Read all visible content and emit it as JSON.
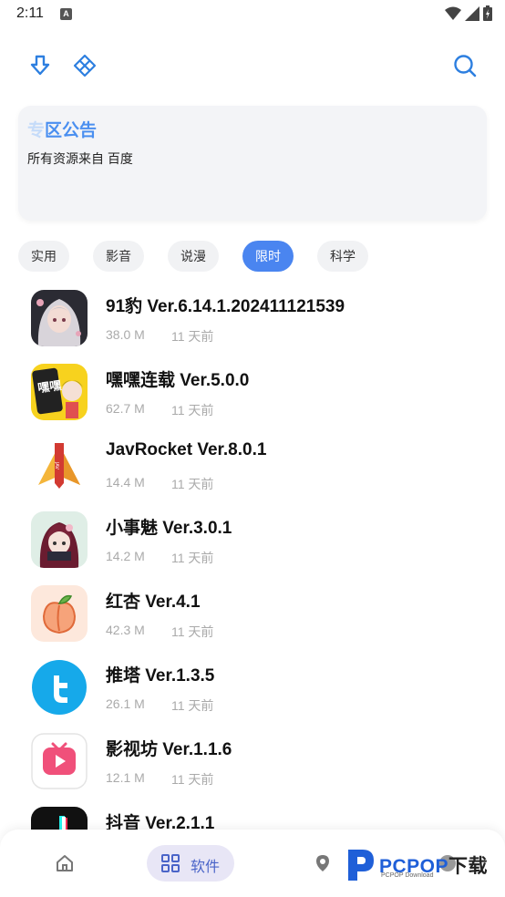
{
  "statusbar": {
    "time": "2:11",
    "indicator": "A"
  },
  "toolbar": {
    "left_icons": [
      "download-icon",
      "diamond-grid-icon"
    ],
    "right_icon": "search-icon",
    "accent": "#2d7fe0"
  },
  "notice": {
    "title_fade": "专",
    "title": "区公告",
    "body": "所有资源来自 百度"
  },
  "tabs": [
    {
      "label": "实用",
      "active": false
    },
    {
      "label": "影音",
      "active": false
    },
    {
      "label": "说漫",
      "active": false
    },
    {
      "label": "限时",
      "active": true
    },
    {
      "label": "科学",
      "active": false
    }
  ],
  "apps": [
    {
      "name": "91豹 Ver.6.14.1.202411121539",
      "size": "38.0 M",
      "time": "11 天前"
    },
    {
      "name": "嘿嘿连载 Ver.5.0.0",
      "size": "62.7 M",
      "time": "11 天前"
    },
    {
      "name": "JavRocket Ver.8.0.1",
      "size": "14.4 M",
      "time": "11 天前"
    },
    {
      "name": "小事魅 Ver.3.0.1",
      "size": "14.2 M",
      "time": "11 天前"
    },
    {
      "name": "红杏 Ver.4.1",
      "size": "42.3 M",
      "time": "11 天前"
    },
    {
      "name": "推塔 Ver.1.3.5",
      "size": "26.1 M",
      "time": "11 天前"
    },
    {
      "name": "影视坊 Ver.1.1.6",
      "size": "12.1 M",
      "time": "11 天前"
    },
    {
      "name": "抖音 Ver.2.1.1",
      "size": "",
      "time": ""
    }
  ],
  "bottom_nav": {
    "software_label": "软件",
    "active_bg": "#e8e6f6"
  },
  "watermark": {
    "brand": "PCPOP",
    "suffix": "下载",
    "sub": "PCPOP Download"
  }
}
